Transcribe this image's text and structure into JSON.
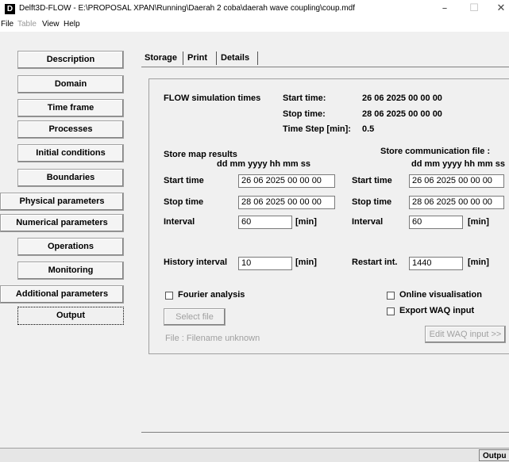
{
  "window": {
    "app_icon": "D",
    "title": "Delft3D-FLOW - E:\\PROPOSAL XPAN\\Running\\Daerah 2 coba\\daerah wave coupling\\coup.mdf",
    "minimize": "–",
    "maximize": "☐",
    "close": "✕"
  },
  "menu": [
    "File",
    "Table",
    "View",
    "Help"
  ],
  "nav": [
    "Description",
    "Domain",
    "Time frame",
    "Processes",
    "Initial conditions",
    "Boundaries",
    "Physical parameters",
    "Numerical parameters",
    "Operations",
    "Monitoring",
    "Additional parameters",
    "Output"
  ],
  "tabs": [
    "Storage",
    "Print",
    "Details"
  ],
  "sim": {
    "label": "FLOW simulation times",
    "start_label": "Start time:",
    "start_value": "26 06 2025 00 00 00",
    "stop_label": "Stop time:",
    "stop_value": "28 06 2025 00 00 00",
    "step_label": "Time Step [min]:",
    "step_value": "0.5"
  },
  "map": {
    "title": "Store map results",
    "format": "dd mm yyyy hh mm ss",
    "start_label": "Start time",
    "start_value": "26 06 2025 00 00 00",
    "stop_label": "Stop time",
    "stop_value": "28 06 2025 00 00 00",
    "interval_label": "Interval",
    "interval_value": "60",
    "unit": "[min]"
  },
  "comm": {
    "title": "Store communication file :",
    "format": "dd mm yyyy hh mm ss",
    "start_label": "Start time",
    "start_value": "26 06 2025 00 00 00",
    "stop_label": "Stop time",
    "stop_value": "28 06 2025 00 00 00",
    "interval_label": "Interval",
    "interval_value": "60",
    "unit": "[min]"
  },
  "history": {
    "label": "History interval",
    "value": "10",
    "unit": "[min]"
  },
  "restart": {
    "label": "Restart int.",
    "value": "1440",
    "unit": "[min]"
  },
  "fourier": {
    "label": "Fourier analysis",
    "checked": false
  },
  "online_vis": {
    "label": "Online visualisation",
    "checked": false
  },
  "export_waq": {
    "label": "Export WAQ input",
    "checked": false
  },
  "select_file": "Select file",
  "file_info": "File : Filename unknown",
  "edit_waq": "Edit WAQ input >>",
  "status": {
    "right": "Outpu"
  }
}
